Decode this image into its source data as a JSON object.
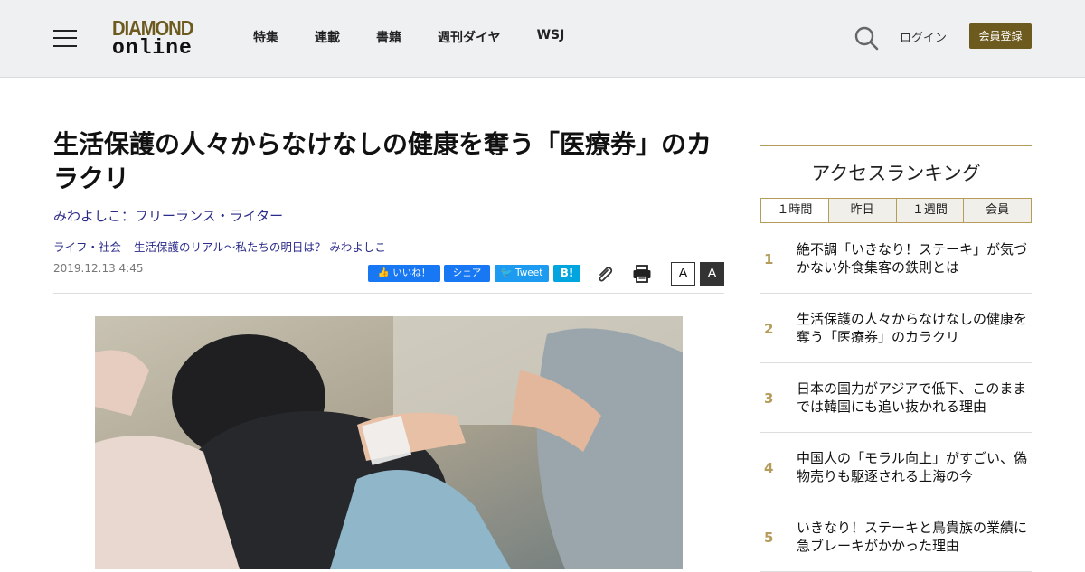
{
  "header": {
    "logo_line1": "DIAMOND",
    "logo_line2": "online",
    "nav": [
      "特集",
      "連載",
      "書籍",
      "週刊ダイヤ",
      "WSJ"
    ],
    "login": "ログイン",
    "register": "会員登録"
  },
  "article": {
    "title": "生活保護の人々からなけなしの健康を奪う「医療券」のカラクリ",
    "author": "みわよしこ：フリーランス・ライター",
    "tags": [
      "ライフ・社会",
      "生活保護のリアル～私たちの明日は？ みわよしこ"
    ],
    "date": "2019.12.13 4:45"
  },
  "share": {
    "like": "いいね！",
    "share": "シェア",
    "tweet": "Tweet",
    "hatena": "B!",
    "font_normal": "A",
    "font_large": "A"
  },
  "ranking": {
    "title": "アクセスランキング",
    "tabs": [
      "１時間",
      "昨日",
      "１週間",
      "会員"
    ],
    "items": [
      {
        "rank": "1",
        "text": "絶不調「いきなり！ステーキ」が気づかない外食集客の鉄則とは"
      },
      {
        "rank": "2",
        "text": "生活保護の人々からなけなしの健康を奪う「医療券」のカラクリ"
      },
      {
        "rank": "3",
        "text": "日本の国力がアジアで低下、このままでは韓国にも追い抜かれる理由"
      },
      {
        "rank": "4",
        "text": "中国人の「モラル向上」がすごい、偽物売りも駆逐される上海の今"
      },
      {
        "rank": "5",
        "text": "いきなり！ステーキと鳥貴族の業績に急ブレーキがかかった理由"
      }
    ]
  },
  "colors": {
    "brand_gold": "#6d5a1f",
    "accent_gold": "#b59c5b",
    "link_blue": "#2b2b8a",
    "facebook": "#1877f2",
    "twitter": "#1d9bf0",
    "hatena": "#00a4de"
  }
}
